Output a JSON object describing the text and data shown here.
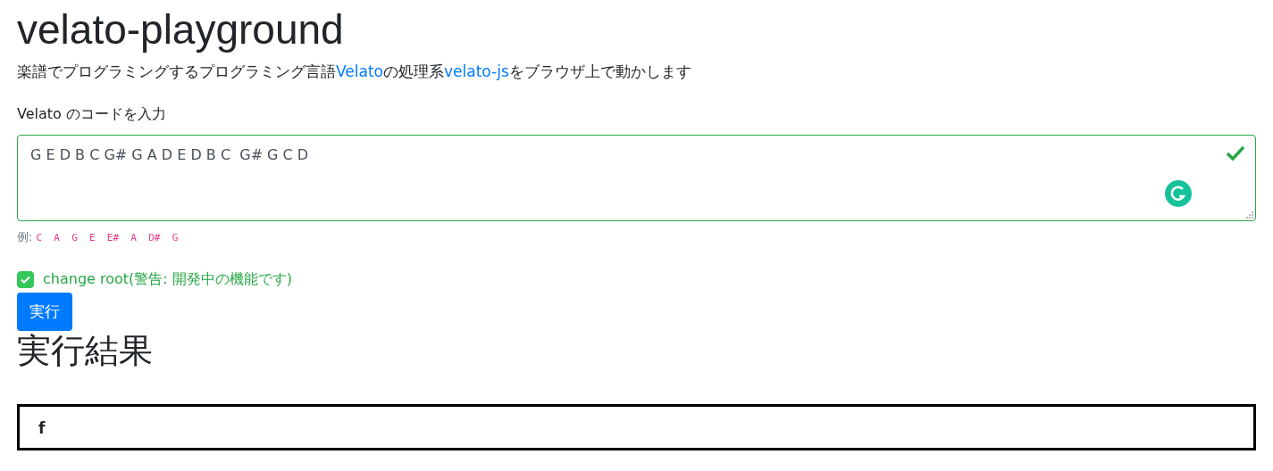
{
  "title": "velato-playground",
  "description": [
    {
      "kind": "text",
      "text": "楽譜でプログラミングするプログラミング言語"
    },
    {
      "kind": "link",
      "text": "Velato"
    },
    {
      "kind": "text",
      "text": "の処理系"
    },
    {
      "kind": "link",
      "text": "velato-js"
    },
    {
      "kind": "text",
      "text": "をブラウザ上で動かします"
    }
  ],
  "code_input": {
    "label": "Velato のコードを入力",
    "value": "G E D B C G# G A D E D B C  G# G C D",
    "valid": true
  },
  "example": {
    "label": "例:",
    "code": "C A G E E# A D# G"
  },
  "change_root": {
    "label": "change root(警告: 開発中の機能です)",
    "checked": true
  },
  "run_button": "実行",
  "result_heading": "実行結果",
  "output": "f"
}
